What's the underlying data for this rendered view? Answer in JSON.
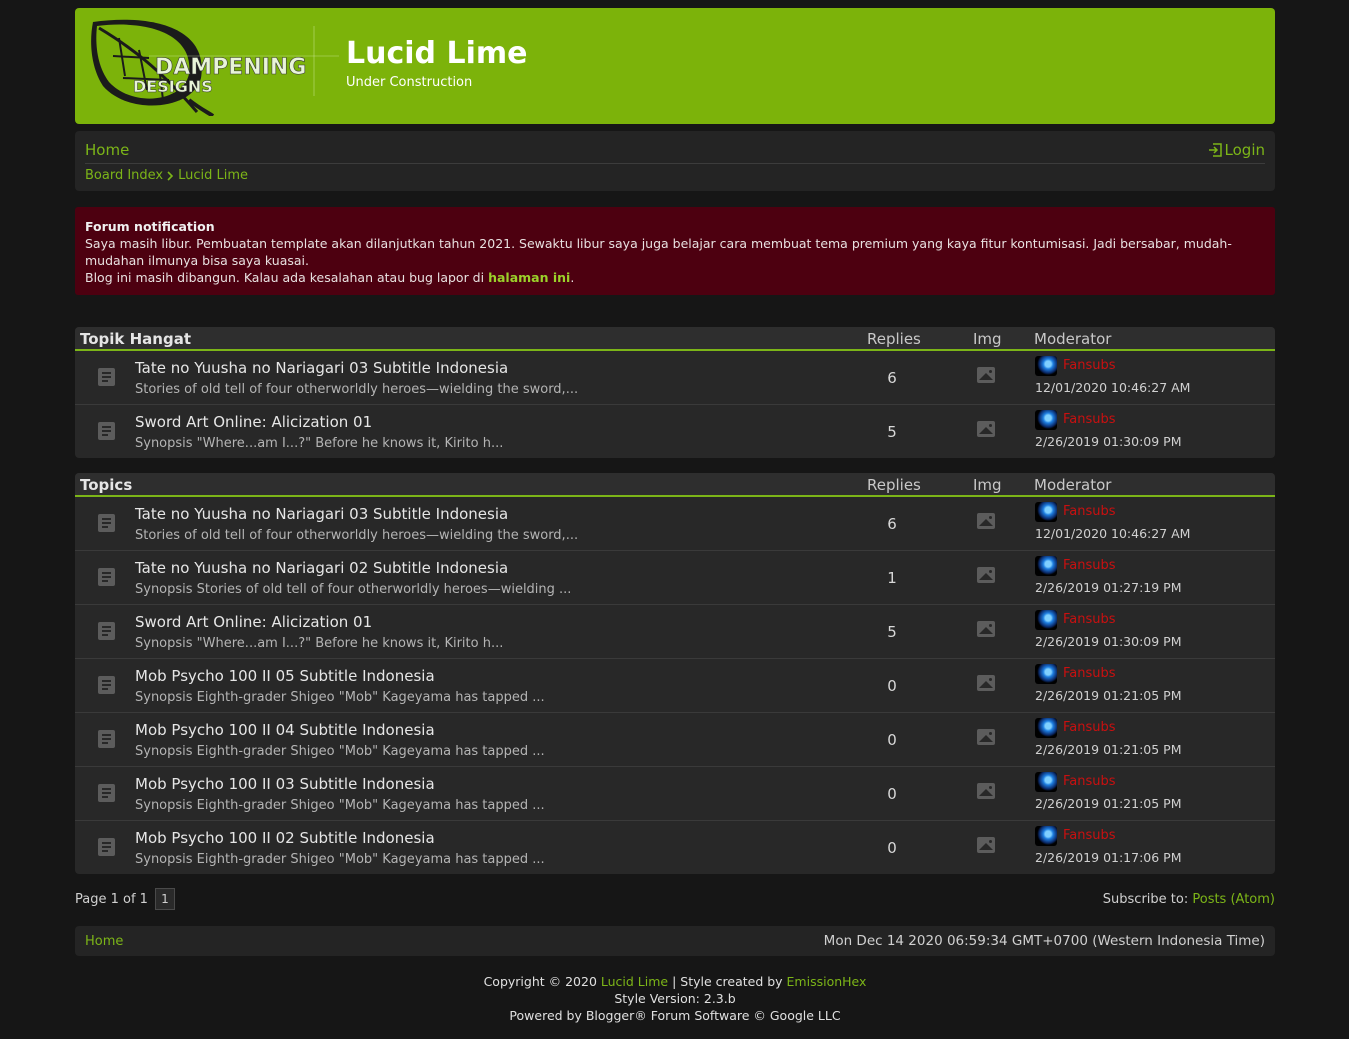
{
  "header": {
    "logo_text_1": "DAMPENING",
    "logo_text_2": "DESIGNS",
    "title": "Lucid Lime",
    "description": "Under Construction"
  },
  "nav": {
    "home": "Home",
    "login": "Login",
    "breadcrumbs": [
      "Board Index",
      "Lucid Lime"
    ]
  },
  "notification": {
    "title": "Forum notification",
    "line1": "Saya masih libur. Pembuatan template akan dilanjutkan tahun 2021. Sewaktu libur saya juga belajar cara membuat tema premium yang kaya fitur kontumisasi. Jadi bersabar, mudah-mudahan ilmunya bisa saya kuasai.",
    "line2_prefix": "Blog ini masih dibangun. Kalau ada kesalahan atau bug lapor di ",
    "line2_link": "halaman ini",
    "line2_suffix": "."
  },
  "columns": {
    "replies": "Replies",
    "img": "Img",
    "moderator": "Moderator"
  },
  "hot_topics": {
    "heading": "Topik Hangat",
    "rows": [
      {
        "title": "Tate no Yuusha no Nariagari 03 Subtitle Indonesia",
        "snippet": "Stories of old tell of four otherworldly heroes—wielding the sword,...",
        "replies": "6",
        "user": "Fansubs",
        "date": "12/01/2020 10:46:27 AM"
      },
      {
        "title": "Sword Art Online: Alicization 01",
        "snippet": "Synopsis \"Where...am I...?\" Before he knows it, Kirito h...",
        "replies": "5",
        "user": "Fansubs",
        "date": "2/26/2019 01:30:09 PM"
      }
    ]
  },
  "topics": {
    "heading": "Topics",
    "rows": [
      {
        "title": "Tate no Yuusha no Nariagari 03 Subtitle Indonesia",
        "snippet": "Stories of old tell of four otherworldly heroes—wielding the sword,...",
        "replies": "6",
        "user": "Fansubs",
        "date": "12/01/2020 10:46:27 AM"
      },
      {
        "title": "Tate no Yuusha no Nariagari 02 Subtitle Indonesia",
        "snippet": "Synopsis Stories of old tell of four otherworldly heroes—wielding ...",
        "replies": "1",
        "user": "Fansubs",
        "date": "2/26/2019 01:27:19 PM"
      },
      {
        "title": "Sword Art Online: Alicization 01",
        "snippet": "Synopsis \"Where...am I...?\" Before he knows it, Kirito h...",
        "replies": "5",
        "user": "Fansubs",
        "date": "2/26/2019 01:30:09 PM"
      },
      {
        "title": "Mob Psycho 100 II 05 Subtitle Indonesia",
        "snippet": "Synopsis Eighth-grader Shigeo \"Mob\" Kageyama has tapped ...",
        "replies": "0",
        "user": "Fansubs",
        "date": "2/26/2019 01:21:05 PM"
      },
      {
        "title": "Mob Psycho 100 II 04 Subtitle Indonesia",
        "snippet": "Synopsis Eighth-grader Shigeo \"Mob\" Kageyama has tapped ...",
        "replies": "0",
        "user": "Fansubs",
        "date": "2/26/2019 01:21:05 PM"
      },
      {
        "title": "Mob Psycho 100 II 03 Subtitle Indonesia",
        "snippet": "Synopsis Eighth-grader Shigeo \"Mob\" Kageyama has tapped ...",
        "replies": "0",
        "user": "Fansubs",
        "date": "2/26/2019 01:21:05 PM"
      },
      {
        "title": "Mob Psycho 100 II 02 Subtitle Indonesia",
        "snippet": "Synopsis Eighth-grader Shigeo \"Mob\" Kageyama has tapped ...",
        "replies": "0",
        "user": "Fansubs",
        "date": "2/26/2019 01:17:06 PM"
      }
    ]
  },
  "pagination": {
    "label": "Page 1 of 1",
    "current": "1",
    "subscribe_label": "Subscribe to: ",
    "subscribe_link": "Posts (Atom)"
  },
  "bottom_bar": {
    "home": "Home",
    "datetime": "Mon Dec 14 2020 06:59:34 GMT+0700 (Western Indonesia Time)"
  },
  "footer": {
    "copyright_prefix": "Copyright © 2020 ",
    "copyright_link": "Lucid Lime",
    "style_prefix": " | Style created by ",
    "style_link": "EmissionHex",
    "version": "Style Version: 2.3.b",
    "powered": "Powered by Blogger® Forum Software © Google LLC"
  },
  "colors": {
    "accent": "#7cb518",
    "header_bg": "#7cb30a",
    "notice_bg": "#4d0010",
    "username": "#c91010",
    "page_bg": "#161616"
  }
}
